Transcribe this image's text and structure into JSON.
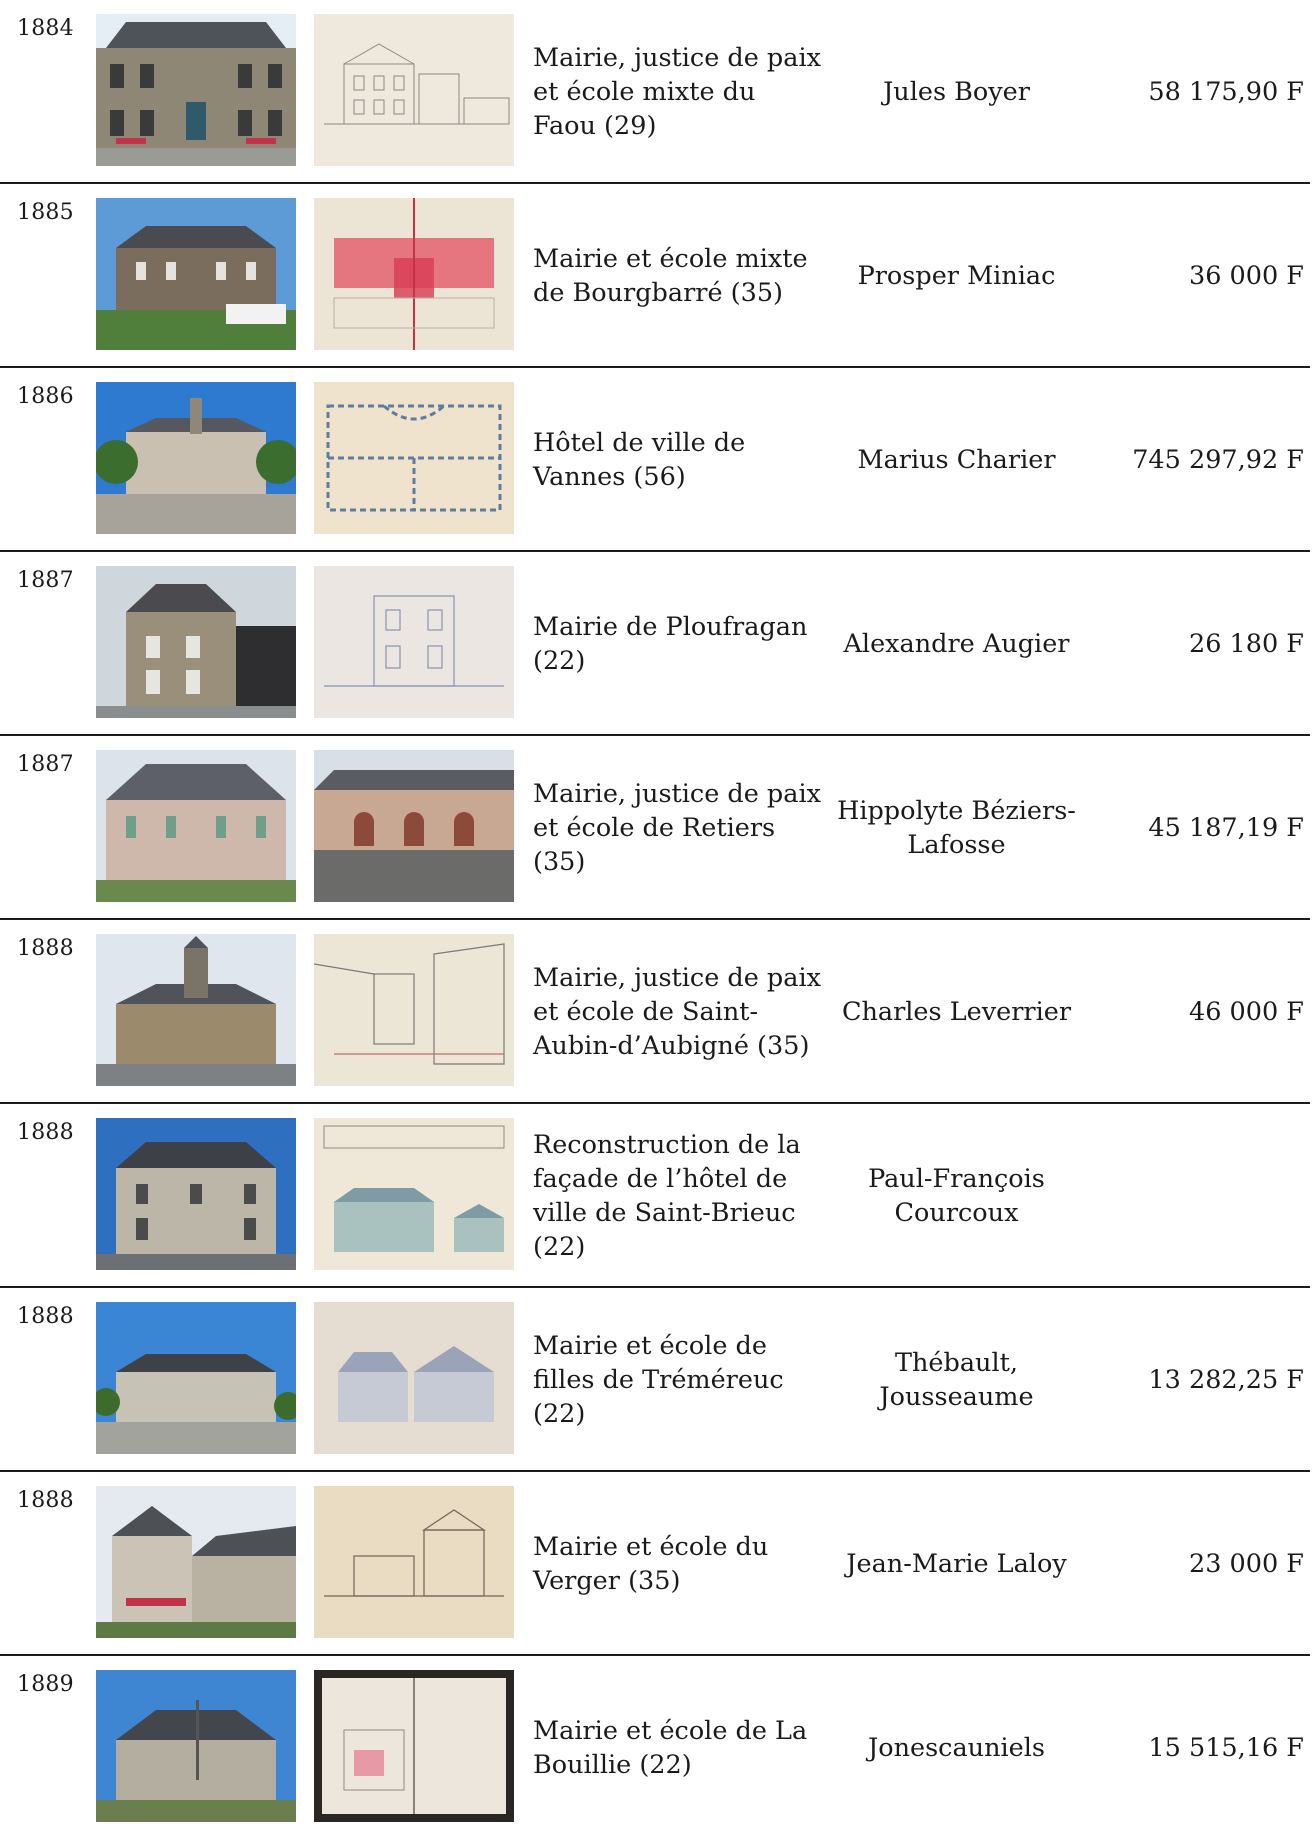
{
  "rows": [
    {
      "year": "1884",
      "photo_icon": "mairie-building-photo",
      "plan_icon": "architectural-elevation-drawing",
      "description": "Mairie, justice de paix et école mixte du Faou (29)",
      "architect": "Jules Boyer",
      "cost": "58 175,90 F"
    },
    {
      "year": "1885",
      "photo_icon": "mairie-building-photo",
      "plan_icon": "architectural-floor-plan",
      "description": "Mairie et école mixte de Bourgbarré (35)",
      "architect": "Prosper Miniac",
      "cost": "36 000 F"
    },
    {
      "year": "1886",
      "photo_icon": "hotel-de-ville-photo",
      "plan_icon": "architectural-floor-plan",
      "description": "Hôtel de ville de Vannes (56)",
      "architect": "Marius Charier",
      "cost": "745 297,92 F"
    },
    {
      "year": "1887",
      "photo_icon": "mairie-building-photo",
      "plan_icon": "architectural-elevation-drawing",
      "description": "Mairie de Ploufragan (22)",
      "architect": "Alexandre Augier",
      "cost": "26 180 F"
    },
    {
      "year": "1887",
      "photo_icon": "mairie-building-photo",
      "plan_icon": "school-building-photo",
      "description": "Mairie, justice de paix et école de Retiers (35)",
      "architect": "Hippolyte Béziers-Lafosse",
      "cost": "45 187,19 F"
    },
    {
      "year": "1888",
      "photo_icon": "mairie-building-photo",
      "plan_icon": "architectural-site-plan",
      "description": "Mairie, justice de paix et école de Saint-Aubin-d’Aubigné (35)",
      "architect": "Charles Leverrier",
      "cost": "46 000 F"
    },
    {
      "year": "1888",
      "photo_icon": "hotel-de-ville-photo",
      "plan_icon": "architectural-elevation-drawing",
      "description": "Reconstruction de la façade de l’hôtel de ville de Saint-Brieuc (22)",
      "architect": "Paul-François Courcoux",
      "cost": ""
    },
    {
      "year": "1888",
      "photo_icon": "mairie-building-photo",
      "plan_icon": "architectural-elevation-drawing",
      "description": "Mairie et école de filles de Tréméreuc (22)",
      "architect": "Thébault, Jousseaume",
      "cost": "13 282,25 F"
    },
    {
      "year": "1888",
      "photo_icon": "mairie-building-photo",
      "plan_icon": "architectural-elevation-drawing",
      "description": "Mairie et école du Verger (35)",
      "architect": "Jean-Marie Laloy",
      "cost": "23 000 F"
    },
    {
      "year": "1889",
      "photo_icon": "mairie-building-photo",
      "plan_icon": "architectural-site-plan",
      "description": "Mairie et école de La Bouillie (22)",
      "architect": "Jonescauniels",
      "cost": "15 515,16 F"
    }
  ]
}
